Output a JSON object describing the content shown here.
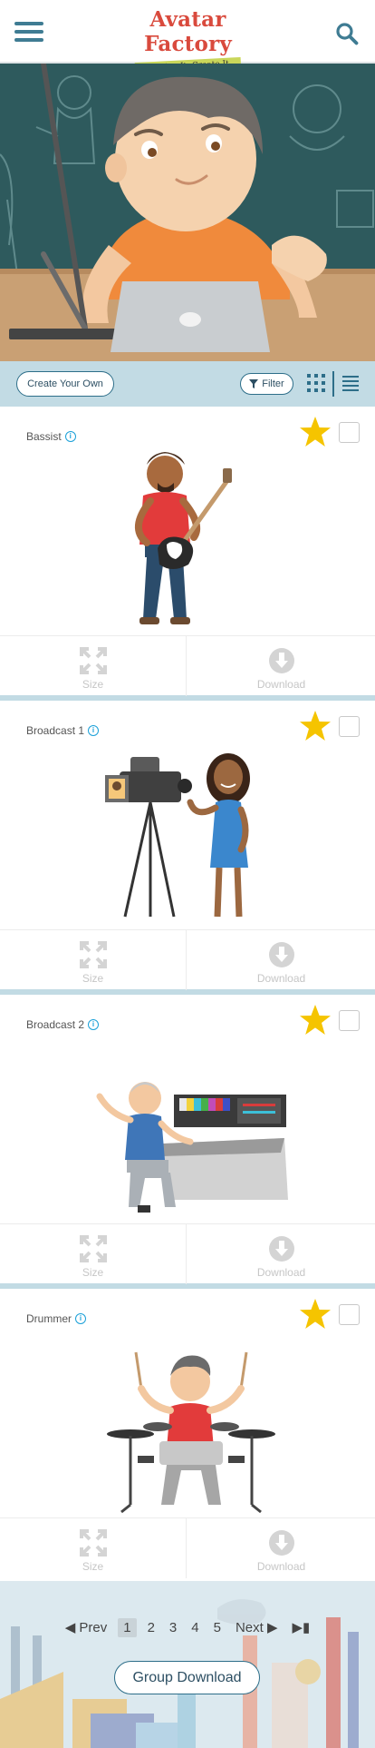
{
  "header": {
    "logo_title": "Avatar Factory",
    "logo_tagline": "Imagine It. Create It.",
    "menu_icon": "hamburger-menu-icon",
    "search_icon": "search-icon"
  },
  "toolbar": {
    "create_label": "Create Your Own",
    "filter_label": "Filter",
    "filter_icon": "funnel-icon",
    "grid_icon": "grid-view-icon",
    "list_icon": "list-view-icon"
  },
  "avatars": [
    {
      "name": "Bassist",
      "favorite": true,
      "selected": false,
      "size_label": "Size",
      "download_label": "Download"
    },
    {
      "name": "Broadcast 1",
      "favorite": true,
      "selected": false,
      "size_label": "Size",
      "download_label": "Download"
    },
    {
      "name": "Broadcast 2",
      "favorite": true,
      "selected": false,
      "size_label": "Size",
      "download_label": "Download"
    },
    {
      "name": "Drummer",
      "favorite": true,
      "selected": false,
      "size_label": "Size",
      "download_label": "Download"
    }
  ],
  "pagination": {
    "prev_label": "Prev",
    "pages": [
      "1",
      "2",
      "3",
      "4",
      "5"
    ],
    "current": "1",
    "next_label": "Next"
  },
  "footer": {
    "group_download_label": "Group Download"
  },
  "colors": {
    "accent": "#2d6e89",
    "star": "#f5c400",
    "toolbar_bg": "#c2dbe4",
    "logo_red": "#d94a3d",
    "info_blue": "#1aa0d8"
  }
}
